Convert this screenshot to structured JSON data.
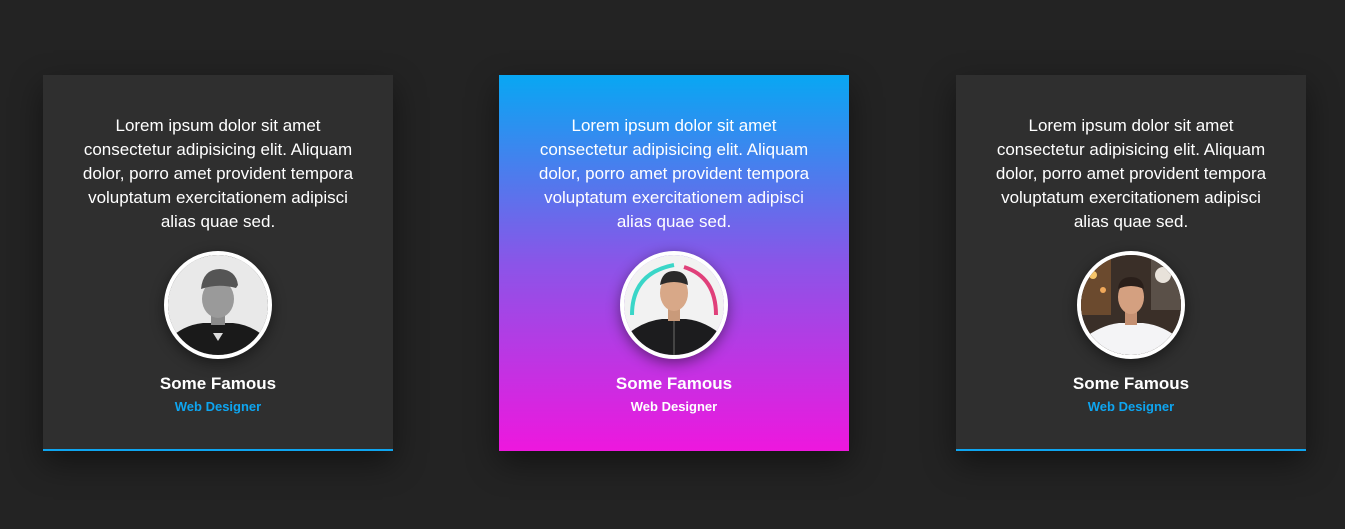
{
  "colors": {
    "page_background": "#232323",
    "card_background": "#2f2f2f",
    "accent": "#0ea5f0",
    "gradient_top": "#08a7f3",
    "gradient_bottom": "#ee17de"
  },
  "cards": [
    {
      "quote": "Lorem ipsum dolor sit amet consectetur adipisicing elit. Aliquam dolor, porro amet provident tempora voluptatum exercitationem adipisci alias quae sed.",
      "name": "Some Famous",
      "role": "Web Designer",
      "avatar_icon": "person-photo-icon",
      "highlighted": false
    },
    {
      "quote": "Lorem ipsum dolor sit amet consectetur adipisicing elit. Aliquam dolor, porro amet provident tempora voluptatum exercitationem adipisci alias quae sed.",
      "name": "Some Famous",
      "role": "Web Designer",
      "avatar_icon": "person-photo-icon",
      "highlighted": true
    },
    {
      "quote": "Lorem ipsum dolor sit amet consectetur adipisicing elit. Aliquam dolor, porro amet provident tempora voluptatum exercitationem adipisci alias quae sed.",
      "name": "Some Famous",
      "role": "Web Designer",
      "avatar_icon": "person-photo-icon",
      "highlighted": false
    }
  ]
}
